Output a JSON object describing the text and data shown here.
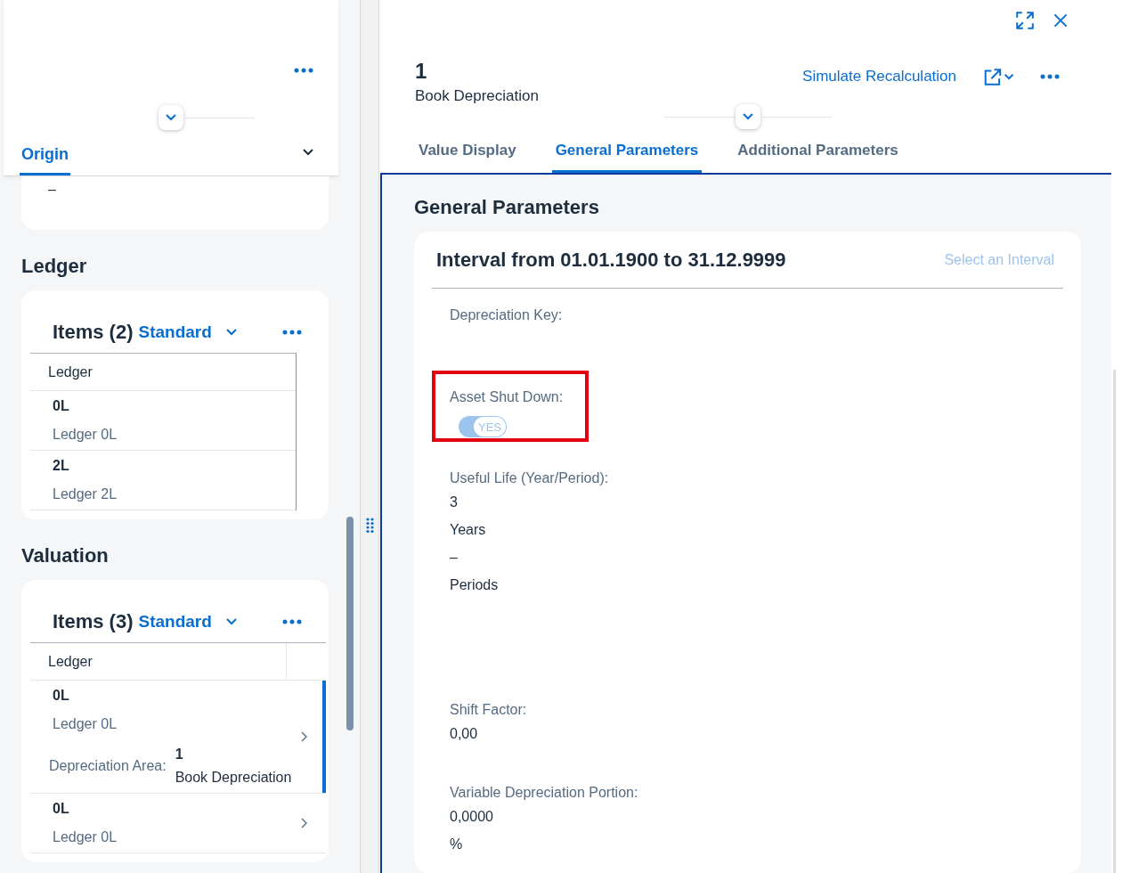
{
  "left_panel": {
    "header_tabs": [
      {
        "label": "Origin",
        "selected": true
      }
    ],
    "origin_value": "–",
    "sections": [
      {
        "title": "Ledger",
        "table": {
          "title": "Items (2)",
          "variant": "Standard",
          "columns": [
            "Ledger"
          ],
          "rows": [
            {
              "ledger": "0L",
              "description": "Ledger 0L",
              "selected": false
            },
            {
              "ledger": "2L",
              "description": "Ledger 2L",
              "selected": false
            }
          ]
        }
      },
      {
        "title": "Valuation",
        "table": {
          "title": "Items (3)",
          "variant": "Standard",
          "columns": [
            "Ledger"
          ],
          "rows": [
            {
              "ledger": "0L",
              "description": "Ledger 0L",
              "detail_label": "Depreciation Area:",
              "detail_value": "1",
              "detail_text": "Book Depreciation",
              "navigable": true,
              "selected": true
            },
            {
              "ledger": "0L",
              "description": "Ledger 0L",
              "navigable": true,
              "selected": false
            }
          ]
        }
      }
    ]
  },
  "detail": {
    "title": "1",
    "subtitle": "Book Depreciation",
    "action": "Simulate Recalculation",
    "tabs": [
      {
        "label": "Value Display",
        "selected": false
      },
      {
        "label": "General Parameters",
        "selected": true
      },
      {
        "label": "Additional Parameters",
        "selected": false
      }
    ],
    "section_title": "General Parameters",
    "card": {
      "title": "Interval from 01.01.1900 to 31.12.9999",
      "link": {
        "label": "Select an Interval",
        "disabled": true
      },
      "fields": [
        {
          "kind": "text",
          "label": "Depreciation Key:"
        },
        {
          "kind": "switch",
          "label": "Asset Shut Down:",
          "highlighted": true,
          "switch": {
            "label": "YES",
            "on": true,
            "disabled": true
          }
        },
        {
          "kind": "text",
          "label": "Useful Life (Year/Period):",
          "values": [
            "3",
            "Years",
            "–",
            "Periods"
          ]
        },
        {
          "kind": "text",
          "label": "Shift Factor:",
          "values": [
            "0,00"
          ]
        },
        {
          "kind": "text",
          "label": "Variable Depreciation Portion:",
          "values": [
            "0,0000",
            "%"
          ]
        }
      ]
    }
  }
}
